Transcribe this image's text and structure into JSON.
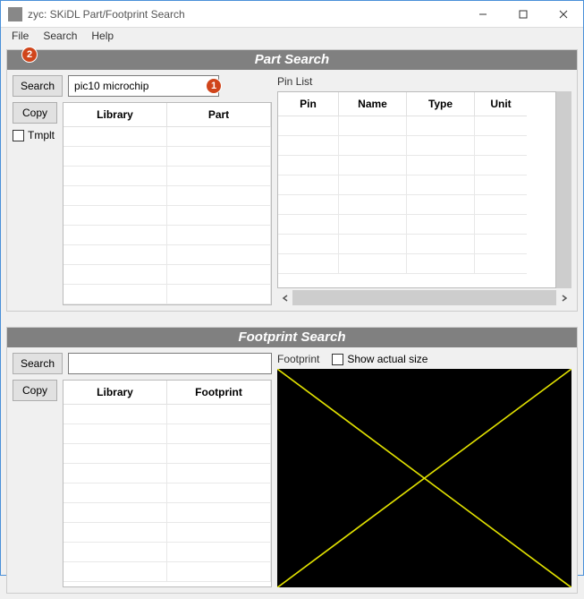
{
  "window": {
    "title": "zyc: SKiDL Part/Footprint Search"
  },
  "menu": {
    "file": "File",
    "search": "Search",
    "help": "Help"
  },
  "badges": {
    "one": "1",
    "two": "2"
  },
  "part_search": {
    "header": "Part Search",
    "search_btn": "Search",
    "copy_btn": "Copy",
    "tmplt_label": "Tmplt",
    "tmplt_checked": false,
    "search_value": "pic10 microchip",
    "table": {
      "columns": [
        "Library",
        "Part"
      ],
      "rows": []
    },
    "pin_list_label": "Pin List",
    "pin_table": {
      "columns": [
        "Pin",
        "Name",
        "Type",
        "Unit"
      ],
      "rows": []
    }
  },
  "footprint_search": {
    "header": "Footprint Search",
    "search_btn": "Search",
    "copy_btn": "Copy",
    "search_value": "",
    "table": {
      "columns": [
        "Library",
        "Footprint"
      ],
      "rows": []
    },
    "footprint_label": "Footprint",
    "show_actual_label": "Show actual size",
    "show_actual_checked": false
  }
}
